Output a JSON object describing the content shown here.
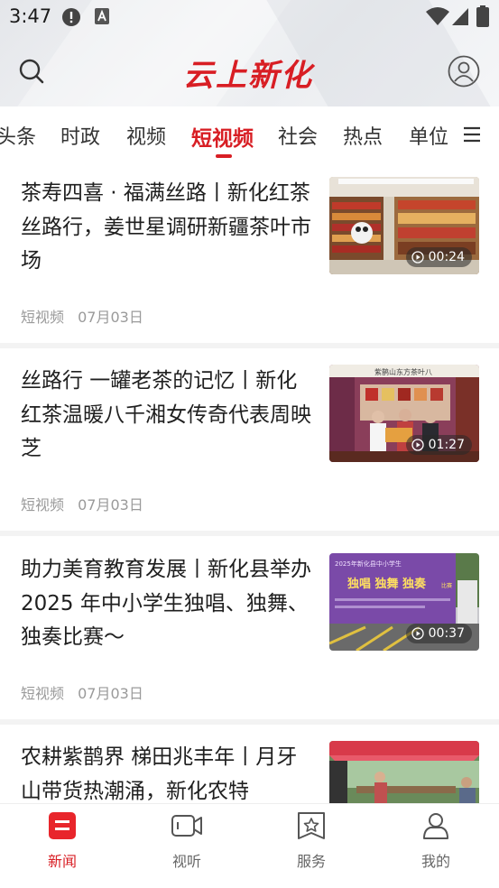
{
  "status_bar": {
    "time": "3:47"
  },
  "header": {
    "logo_text": "云上新化"
  },
  "tabs": [
    {
      "label": "头条"
    },
    {
      "label": "时政"
    },
    {
      "label": "视频"
    },
    {
      "label": "短视频",
      "active": true
    },
    {
      "label": "社会"
    },
    {
      "label": "热点"
    },
    {
      "label": "单位"
    }
  ],
  "articles": [
    {
      "title": "茶寿四喜 · 福满丝路丨新化红茶丝路行，姜世星调研新疆茶叶市场",
      "category": "短视频",
      "date": "07月03日",
      "duration": "00:24"
    },
    {
      "title": "丝路行 一罐老茶的记忆丨新化红茶温暖八千湘女传奇代表周映芝",
      "category": "短视频",
      "date": "07月03日",
      "duration": "01:27"
    },
    {
      "title": "助力美育教育发展丨新化县举办 2025 年中小学生独唱、独舞、独奏比赛～",
      "category": "短视频",
      "date": "07月03日",
      "duration": "00:37"
    },
    {
      "title": "农耕紫鹊界 梯田兆丰年丨月牙山带货热潮涌，新化农特",
      "category": "",
      "date": "",
      "duration": ""
    }
  ],
  "thumb_texts": {
    "banner_top": "2025年新化县中小学生",
    "banner_main": "独唱 独舞 独奏",
    "banner_suffix": "比赛",
    "sign": "紫鹊山东方茶叶八"
  },
  "bottom_nav": [
    {
      "label": "新闻",
      "icon": "news-icon",
      "active": true
    },
    {
      "label": "视听",
      "icon": "video-camera-icon"
    },
    {
      "label": "服务",
      "icon": "service-star-icon"
    },
    {
      "label": "我的",
      "icon": "profile-icon"
    }
  ],
  "colors": {
    "accent": "#d81e24",
    "meta_text": "#9a9a9a",
    "separator": "#f3f3f3"
  }
}
